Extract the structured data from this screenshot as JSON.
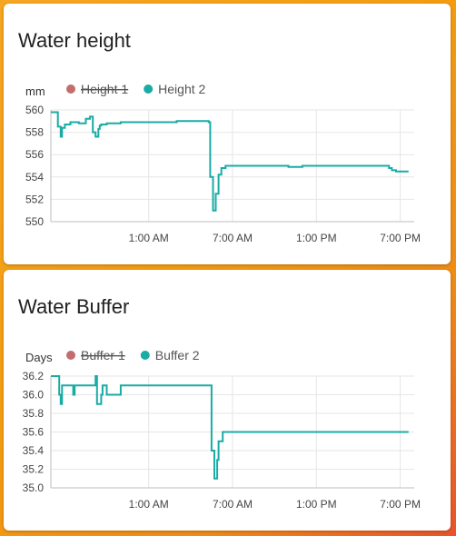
{
  "cards": [
    {
      "title": "Water height"
    },
    {
      "title": "Water Buffer"
    }
  ],
  "chart_data": [
    {
      "type": "line",
      "title": "Water height",
      "ylabel": "mm",
      "xlabel": "",
      "ylim": [
        550,
        560
      ],
      "yticks": [
        560,
        558,
        556,
        554,
        552,
        550
      ],
      "xlim": [
        -6,
        20
      ],
      "xticks": [
        1,
        7,
        13,
        19
      ],
      "xtick_labels": [
        "1:00 AM",
        "7:00 AM",
        "1:00 PM",
        "7:00 PM"
      ],
      "grid": true,
      "legend_position": "top-left",
      "series": [
        {
          "name": "Height 1",
          "color": "#c26e6e",
          "hidden": true,
          "x": [],
          "y": []
        },
        {
          "name": "Height 2",
          "color": "#1aaba5",
          "hidden": false,
          "x": [
            -6.0,
            -5.6,
            -5.5,
            -5.3,
            -5.2,
            -5.0,
            -4.6,
            -4.0,
            -3.5,
            -3.2,
            -3.0,
            -2.8,
            -2.6,
            -2.5,
            -2.4,
            -2.0,
            -1.0,
            0.0,
            1.0,
            2.0,
            3.0,
            4.0,
            5.0,
            5.3,
            5.4,
            5.6,
            5.8,
            6.0,
            6.2,
            6.5,
            7.0,
            8.0,
            9.0,
            10.0,
            11.0,
            12.0,
            13.0,
            14.0,
            15.0,
            16.0,
            17.0,
            18.0,
            18.2,
            18.4,
            18.7,
            19.0,
            19.4,
            19.6
          ],
          "y": [
            559.8,
            559.8,
            558.5,
            557.6,
            558.4,
            558.7,
            558.9,
            558.8,
            559.2,
            559.4,
            558.0,
            557.6,
            558.3,
            558.6,
            558.7,
            558.8,
            558.9,
            558.9,
            558.9,
            558.9,
            559.0,
            559.0,
            559.0,
            558.9,
            554.0,
            551.0,
            552.5,
            554.2,
            554.8,
            555.0,
            555.0,
            555.0,
            555.0,
            555.0,
            554.9,
            555.0,
            555.0,
            555.0,
            555.0,
            555.0,
            555.0,
            555.0,
            554.8,
            554.6,
            554.5,
            554.5,
            554.5,
            554.5
          ]
        }
      ]
    },
    {
      "type": "line",
      "title": "Water Buffer",
      "ylabel": "Days",
      "xlabel": "",
      "ylim": [
        35.0,
        36.2
      ],
      "yticks": [
        36.2,
        36.0,
        35.8,
        35.6,
        35.4,
        35.2,
        35.0
      ],
      "ytick_labels": [
        "36.2",
        "36.0",
        "35.8",
        "35.6",
        "35.4",
        "35.2",
        "35.0"
      ],
      "xlim": [
        -6,
        20
      ],
      "xticks": [
        1,
        7,
        13,
        19
      ],
      "xtick_labels": [
        "1:00 AM",
        "7:00 AM",
        "1:00 PM",
        "7:00 PM"
      ],
      "grid": true,
      "legend_position": "top-left",
      "series": [
        {
          "name": "Buffer 1",
          "color": "#c26e6e",
          "hidden": true,
          "x": [],
          "y": []
        },
        {
          "name": "Buffer 2",
          "color": "#1aaba5",
          "hidden": false,
          "x": [
            -6.0,
            -5.5,
            -5.4,
            -5.3,
            -5.2,
            -5.0,
            -4.5,
            -4.4,
            -4.3,
            -4.0,
            -3.5,
            -3.0,
            -2.8,
            -2.7,
            -2.6,
            -2.4,
            -2.3,
            -2.0,
            -1.0,
            0.0,
            2.0,
            4.0,
            5.0,
            5.4,
            5.5,
            5.7,
            5.9,
            6.0,
            6.1,
            6.3,
            7.0,
            10.0,
            13.0,
            16.0,
            18.0,
            18.5,
            19.4,
            19.6
          ],
          "y": [
            36.2,
            36.2,
            36.0,
            35.9,
            36.1,
            36.1,
            36.1,
            36.0,
            36.1,
            36.1,
            36.1,
            36.1,
            36.2,
            35.9,
            35.9,
            36.0,
            36.1,
            36.0,
            36.1,
            36.1,
            36.1,
            36.1,
            36.1,
            36.1,
            35.4,
            35.1,
            35.3,
            35.5,
            35.5,
            35.6,
            35.6,
            35.6,
            35.6,
            35.6,
            35.6,
            35.6,
            35.6,
            35.6
          ]
        }
      ]
    }
  ]
}
